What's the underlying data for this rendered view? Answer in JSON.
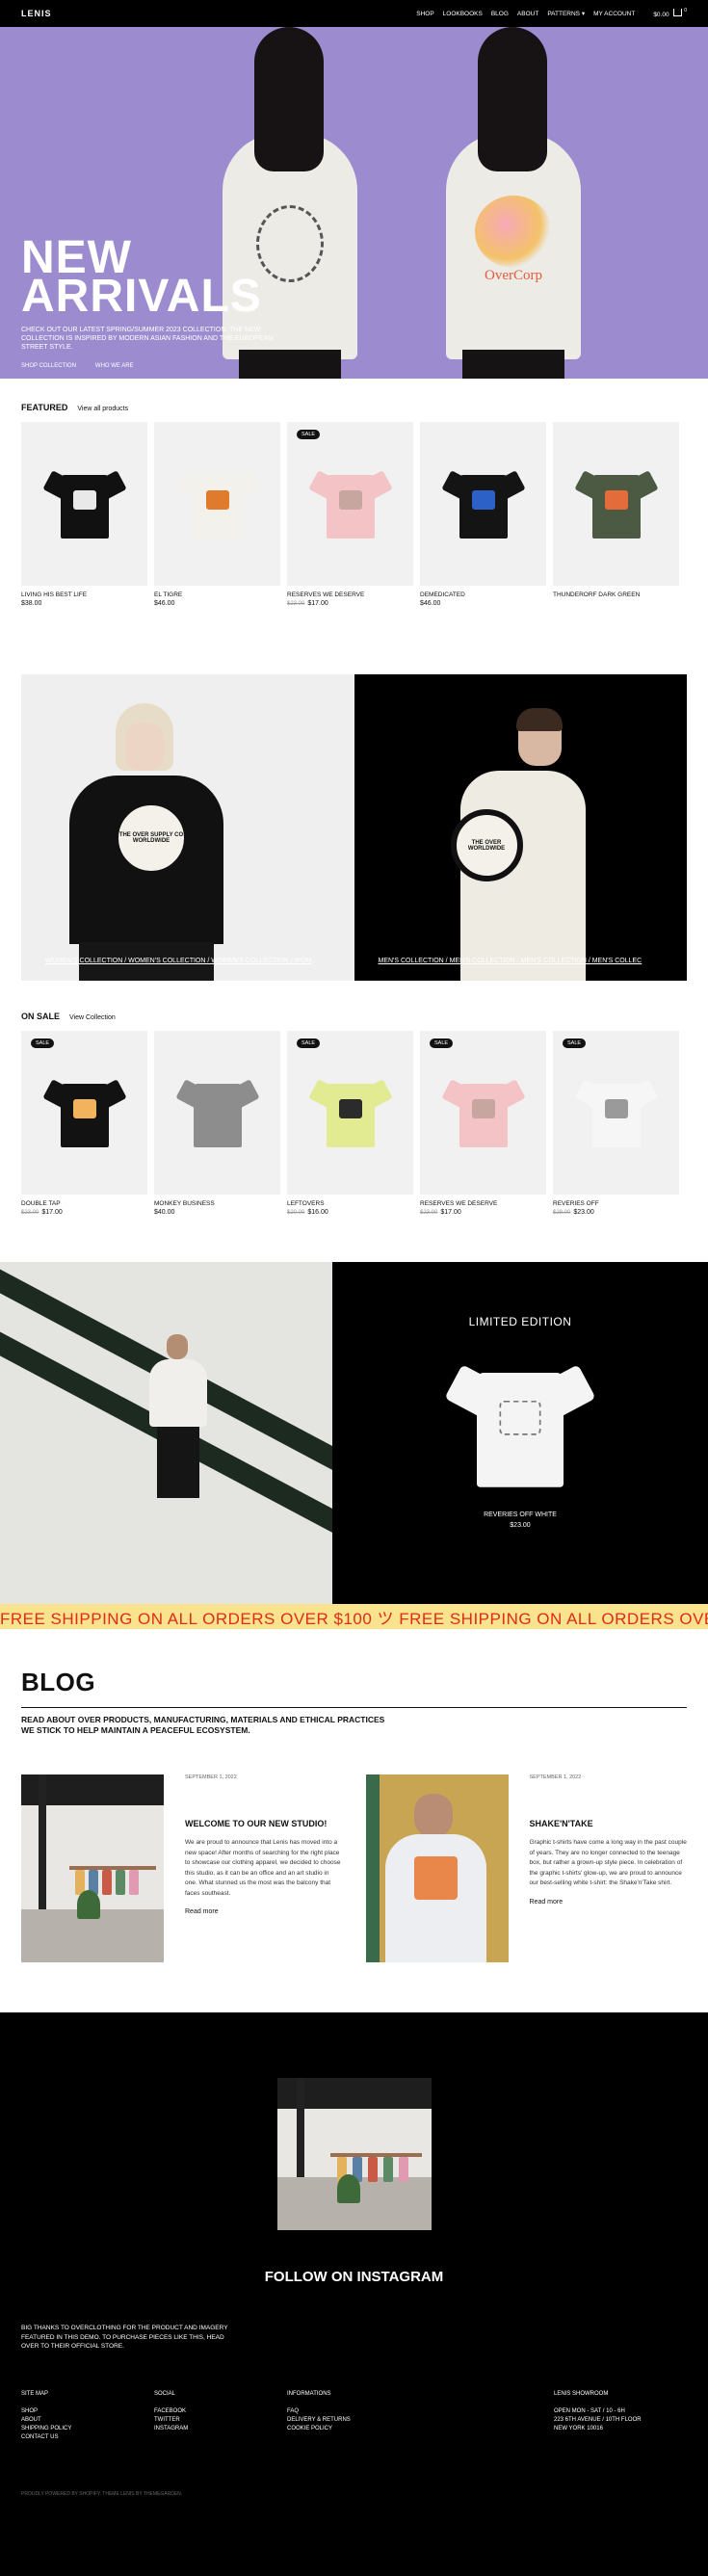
{
  "header": {
    "logo": "LENIS",
    "nav": [
      "SHOP",
      "LOOKBOOKS",
      "BLOG",
      "ABOUT",
      "PATTERNS ▾",
      "MY ACCOUNT"
    ],
    "cart_total": "$0.00",
    "cart_count": "0"
  },
  "hero": {
    "title_line1": "NEW",
    "title_line2": "ARRIVALS",
    "subtitle": "CHECK OUT OUR LATEST SPRING/SUMMER 2023 COLLECTION. THE NEW COLLECTION IS INSPIRED BY MODERN ASIAN FASHION AND THE EUROPEAN STREET STYLE.",
    "link1": "SHOP COLLECTION",
    "link2": "WHO WE ARE",
    "shirt2_text": "OverCorp"
  },
  "featured": {
    "title": "FEATURED",
    "link": "View all products",
    "products": [
      {
        "name": "LIVING HIS BEST LIFE",
        "price": "$38.00",
        "old_price": "",
        "sale": false,
        "color": "#111111",
        "print": "#e9e9e9"
      },
      {
        "name": "EL TIGRE",
        "price": "$46.00",
        "old_price": "",
        "sale": false,
        "color": "#f3f1ec",
        "print": "#e07b2e"
      },
      {
        "name": "RESERVES WE DESERVE",
        "price": "$17.00",
        "old_price": "$23.00",
        "sale": true,
        "color": "#f3c3c6",
        "print": "#c7a6a0"
      },
      {
        "name": "DEMEDICATED",
        "price": "$46.00",
        "old_price": "",
        "sale": false,
        "color": "#141414",
        "print": "#2c62c7"
      },
      {
        "name": "THUNDERORF DARK GREEN",
        "price": "",
        "old_price": "",
        "sale": false,
        "color": "#4c5a44",
        "print": "#e46b3a"
      }
    ],
    "sale_badge": "SALE"
  },
  "collections": {
    "womens": "WOMEN'S COLLECTION / WOMEN'S COLLECTION / WOMEN'S COLLECTION / WOM",
    "mens": "MEN'S COLLECTION / MEN'S COLLECTION / MEN'S COLLECTION / MEN'S COLLEC",
    "print_text": "THE OVER SUPPLY CO WORLDWIDE",
    "print_text2": "THE OVER WORLDWIDE"
  },
  "on_sale": {
    "title": "ON SALE",
    "link": "View Collection",
    "products": [
      {
        "name": "DOUBLE TAP",
        "price": "$17.00",
        "old_price": "$23.00",
        "sale": true,
        "color": "#121212",
        "print": "#f1b35b"
      },
      {
        "name": "MONKEY BUSINESS",
        "price": "$40.00",
        "old_price": "",
        "sale": false,
        "color": "#8d8d8d",
        "print": "#8d8d8d"
      },
      {
        "name": "LEFTOVERS",
        "price": "$16.00",
        "old_price": "$20.00",
        "sale": true,
        "color": "#e2eb92",
        "print": "#2b2b2b"
      },
      {
        "name": "RESERVES WE DESERVE",
        "price": "$17.00",
        "old_price": "$23.00",
        "sale": true,
        "color": "#f3c3c6",
        "print": "#c7a6a0"
      },
      {
        "name": "REVERIES OFF",
        "price": "$23.00",
        "old_price": "$28.00",
        "sale": true,
        "color": "#f6f6f6",
        "print": "#9a9a9a"
      }
    ],
    "sale_badge": "SALE"
  },
  "limited": {
    "title": "LIMITED EDITION",
    "product_name": "REVERIES OFF WHITE",
    "price": "$23.00"
  },
  "ticker": {
    "text": "FREE SHIPPING ON ALL ORDERS OVER $100 ツ FREE SHIPPING ON ALL ORDERS OVER $100 ツ FREE SHIPPING ON ALL ORDERS OVER $100"
  },
  "blog": {
    "title": "BLOG",
    "subtitle": "READ ABOUT OVER PRODUCTS, MANUFACTURING, MATERIALS AND ETHICAL PRACTICES WE STICK TO HELP MAINTAIN A PEACEFUL ECOSYSTEM.",
    "posts": [
      {
        "date": "SEPTEMBER 1, 2022",
        "title": "WELCOME TO OUR NEW STUDIO!",
        "text": "We are proud to announce that Lenis has moved into a new space! After months of searching for the right place to showcase our clothing apparel, we decided to choose this studio, as it can be an office and an art studio in one. What stunned us the most was the balcony that faces southeast.",
        "read_more": "Read more"
      },
      {
        "date": "SEPTEMBER 1, 2022",
        "title": "SHAKE'N'TAKE",
        "text": "Graphic t-shirts have come a long way in the past couple of years. They are no longer connected to the teenage box, but rather a grown-up style piece. In celebration of the graphic t-shirts' glow-up, we are proud to announce our best-selling white t-shirt: the Shake'n'Take shirt.",
        "read_more": "Read more"
      }
    ]
  },
  "footer": {
    "insta_title": "FOLLOW ON INSTAGRAM",
    "credits": "BIG THANKS TO OVERCLOTHING FOR THE PRODUCT AND IMAGERY FEATURED IN THIS DEMO. TO PURCHASE PIECES LIKE THIS, HEAD OVER TO THEIR OFFICIAL STORE.",
    "columns": [
      {
        "heading": "SITE MAP",
        "items": [
          "SHOP",
          "ABOUT",
          "SHIPPING POLICY",
          "CONTACT US"
        ]
      },
      {
        "heading": "SOCIAL",
        "items": [
          "FACEBOOK",
          "TWITTER",
          "INSTAGRAM"
        ]
      },
      {
        "heading": "INFORMATIONS",
        "items": [
          "FAQ",
          "DELIVERY & RETURNS",
          "COOKIE POLICY"
        ]
      },
      {
        "heading": "LENIS SHOWROOM",
        "items": [
          "OPEN MON - SAT / 10 - 6H",
          "223 6TH AVENUE / 10TH FLOOR",
          "NEW YORK 10016"
        ]
      }
    ],
    "copyright": "PROUDLY POWERED BY SHOPIFY. THEME LENIS BY THEMEGARDEN."
  }
}
